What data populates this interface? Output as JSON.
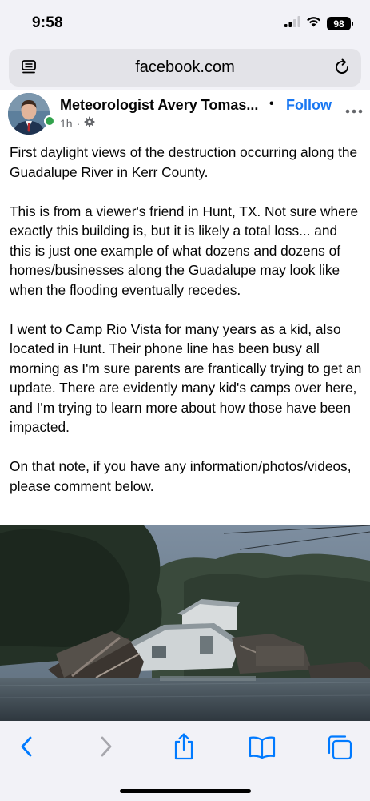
{
  "status_bar": {
    "time": "9:58",
    "battery": "98",
    "icons": [
      "cellular-signal-icon",
      "wifi-icon",
      "battery-icon"
    ]
  },
  "browser": {
    "url": "facebook.com",
    "icons": [
      "reader-mode-icon",
      "reload-icon"
    ]
  },
  "post": {
    "author": "Meteorologist Avery Tomas...",
    "separator": "•",
    "follow_label": "Follow",
    "time_ago": "1h",
    "meta_separator": "·",
    "paragraphs": [
      "First daylight views of the destruction occurring along the Guadalupe River in Kerr County.",
      "This is from a viewer's friend in Hunt, TX. Not sure where exactly this building is, but it is likely a total loss... and this is just one example of what dozens and dozens of homes/businesses along the Guadalupe may look like when the flooding eventually recedes.",
      "I went to Camp Rio Vista for many years as a kid, also located in Hunt. Their phone line has been busy all morning as I'm sure parents are frantically trying to get an update. There are evidently many kid's camps over here, and I'm trying to learn more about how those have been impacted.",
      "On that note, if you have any information/photos/videos, please comment below."
    ]
  },
  "toolbar": {
    "icons": [
      "back-icon",
      "forward-icon",
      "share-icon",
      "bookmarks-icon",
      "tabs-icon"
    ]
  },
  "colors": {
    "link_blue": "#1877f2",
    "safari_blue": "#007aff",
    "chrome_bg": "#f2f2f7",
    "online_green": "#31a24c"
  }
}
